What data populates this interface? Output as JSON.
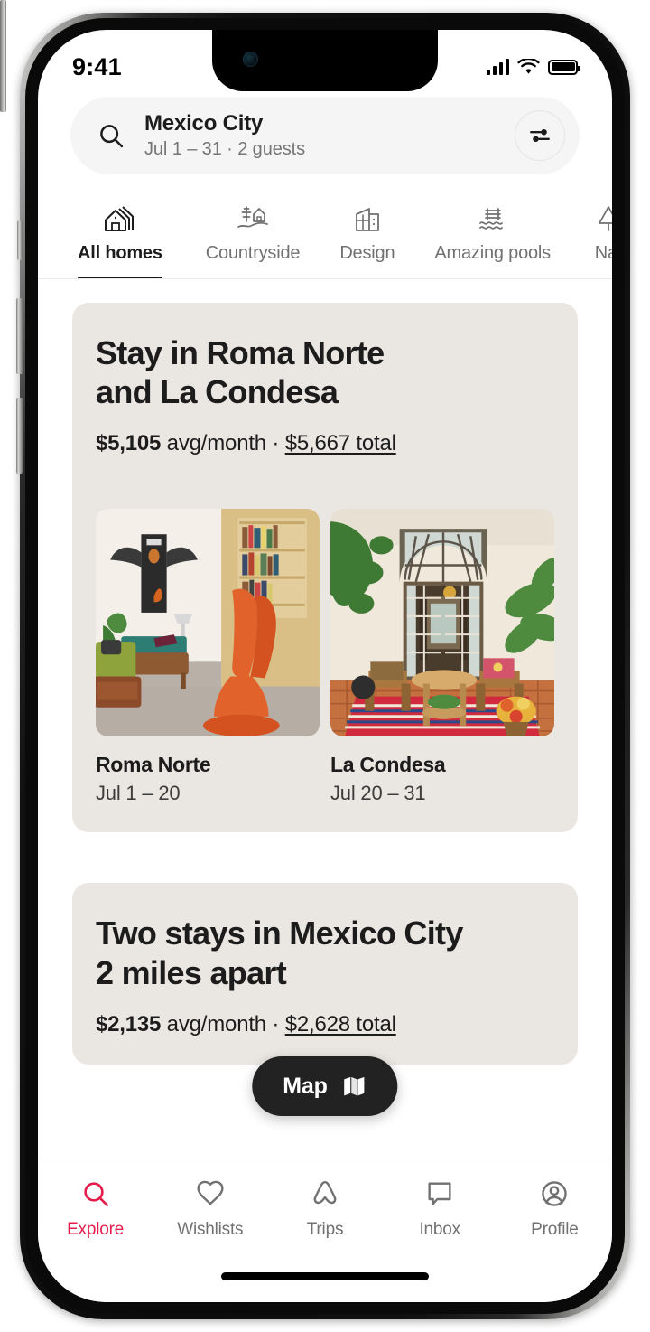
{
  "status_bar": {
    "time": "9:41",
    "cellular_icon": "signal-bars-icon",
    "wifi_icon": "wifi-icon",
    "battery_icon": "battery-full-icon"
  },
  "search": {
    "search_icon": "search-icon",
    "destination": "Mexico City",
    "details": "Jul 1 – 31 · 2 guests",
    "filter_icon": "filter-sliders-icon"
  },
  "categories": [
    {
      "label": "All homes",
      "icon": "houses-icon",
      "active": true
    },
    {
      "label": "Countryside",
      "icon": "countryside-icon",
      "active": false
    },
    {
      "label": "Design",
      "icon": "design-building-icon",
      "active": false
    },
    {
      "label": "Amazing pools",
      "icon": "pool-icon",
      "active": false
    },
    {
      "label": "Nat",
      "icon": "nature-icon",
      "active": false
    }
  ],
  "cards": [
    {
      "title": "Stay in Roma Norte\nand La Condesa",
      "price_amount": "$5,105",
      "price_unit": " avg/month · ",
      "price_total": "$5,667 total",
      "stays": [
        {
          "name": "Roma Norte",
          "dates": "Jul 1 – 20",
          "photo": "living-room-orange-chair"
        },
        {
          "name": "La Condesa",
          "dates": "Jul 20 – 31",
          "photo": "courtyard-arched-window"
        }
      ]
    },
    {
      "title": "Two stays in Mexico City\n2 miles apart",
      "price_amount": "$2,135",
      "price_unit": " avg/month · ",
      "price_total": "$2,628 total",
      "stays": []
    }
  ],
  "map_button": {
    "label": "Map",
    "icon": "folded-map-icon"
  },
  "bottom_nav": [
    {
      "label": "Explore",
      "icon": "search-icon",
      "active": true
    },
    {
      "label": "Wishlists",
      "icon": "heart-icon",
      "active": false
    },
    {
      "label": "Trips",
      "icon": "airbnb-belo-icon",
      "active": false
    },
    {
      "label": "Inbox",
      "icon": "message-bubble-icon",
      "active": false
    },
    {
      "label": "Profile",
      "icon": "user-circle-icon",
      "active": false
    }
  ],
  "colors": {
    "accent": "#E61E4D",
    "card_bg": "#EAE7E2",
    "pill_bg": "#222222",
    "muted_text": "#717171"
  }
}
